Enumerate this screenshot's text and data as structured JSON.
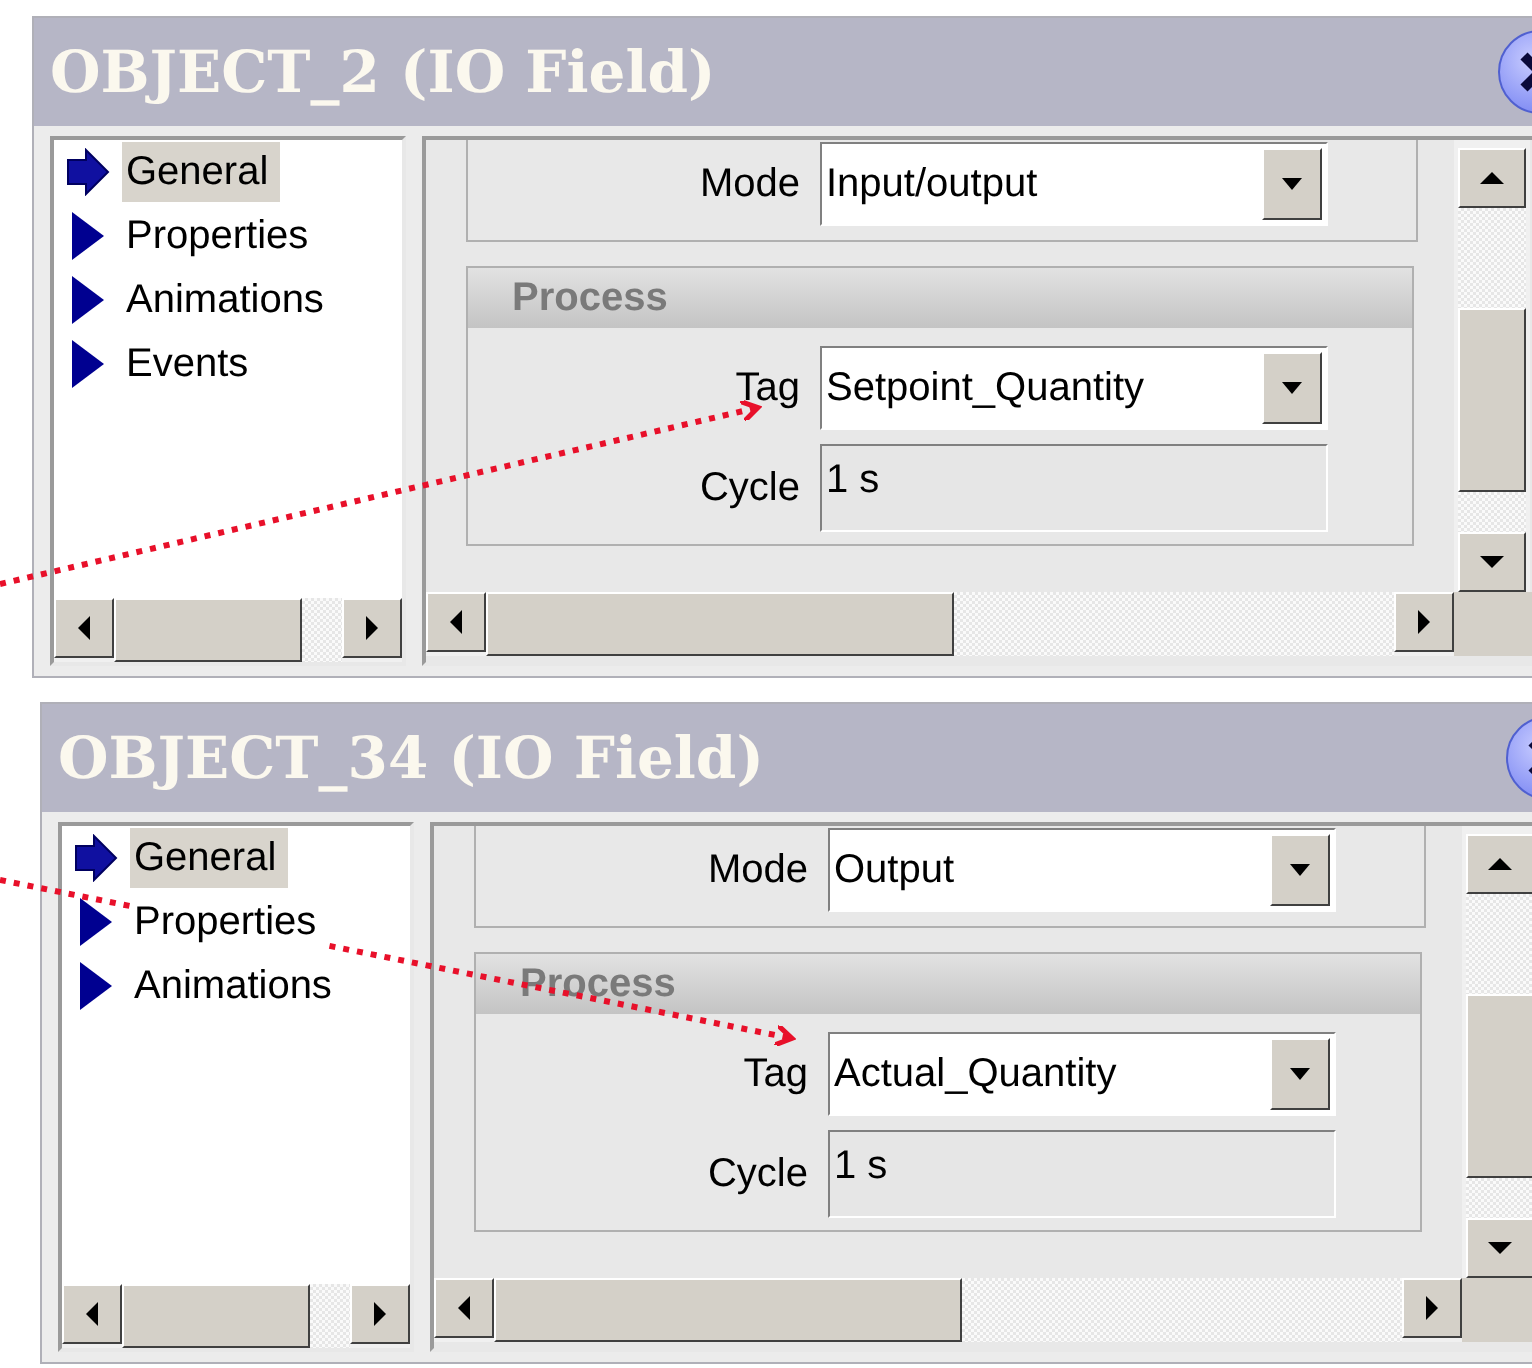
{
  "windows": [
    {
      "title": "OBJECT_2 (IO Field)",
      "nav": [
        {
          "label": "General",
          "selected": true
        },
        {
          "label": "Properties",
          "selected": false
        },
        {
          "label": "Animations",
          "selected": false
        },
        {
          "label": "Events",
          "selected": false
        }
      ],
      "mode": {
        "label": "Mode",
        "value": "Input/output",
        "kind": "combo"
      },
      "group": {
        "title": "Process",
        "fields": [
          {
            "label": "Tag",
            "value": "Setpoint_Quantity",
            "kind": "combo"
          },
          {
            "label": "Cycle",
            "value": "1 s",
            "kind": "text"
          }
        ]
      }
    },
    {
      "title": "OBJECT_34 (IO Field)",
      "nav": [
        {
          "label": "General",
          "selected": true
        },
        {
          "label": "Properties",
          "selected": false
        },
        {
          "label": "Animations",
          "selected": false
        }
      ],
      "mode": {
        "label": "Mode",
        "value": "Output",
        "kind": "combo"
      },
      "group": {
        "title": "Process",
        "fields": [
          {
            "label": "Tag",
            "value": "Actual_Quantity",
            "kind": "combo"
          },
          {
            "label": "Cycle",
            "value": "1 s",
            "kind": "text"
          }
        ]
      }
    }
  ]
}
